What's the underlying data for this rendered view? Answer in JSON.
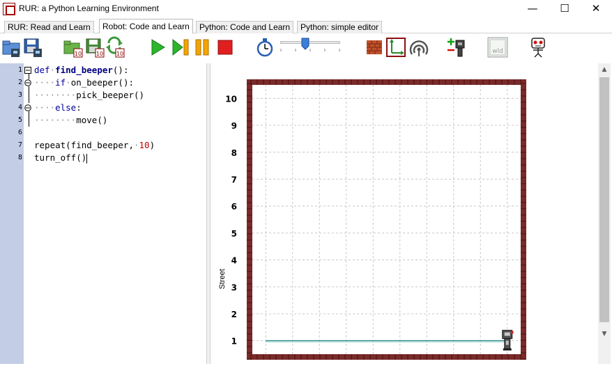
{
  "window": {
    "title": "RUR: a Python Learning Environment",
    "minimize_glyph": "—",
    "maximize_glyph": "☐",
    "close_glyph": "✕"
  },
  "tabs": [
    {
      "label": "RUR: Read and Learn",
      "active": false
    },
    {
      "label": "Robot: Code and Learn",
      "active": true
    },
    {
      "label": "Python: Code and Learn",
      "active": false
    },
    {
      "label": "Python: simple editor",
      "active": false
    }
  ],
  "toolbar": {
    "icons": [
      "open-world-icon",
      "save-world-icon",
      "open-program-icon",
      "save-program-icon",
      "reload-icon",
      "run-icon",
      "step-icon",
      "pause-icon",
      "stop-icon",
      "speed-timer-icon",
      "world-builder-wall-icon",
      "resize-world-icon",
      "beeper-sensor-icon",
      "add-robot-icon",
      "world-file-icon",
      "robot-face-icon"
    ],
    "speed_slider_fraction": 0.4,
    "world_file_label": "wld"
  },
  "editor": {
    "lines": [
      {
        "n": "1"
      },
      {
        "n": "2"
      },
      {
        "n": "3"
      },
      {
        "n": "4"
      },
      {
        "n": "5"
      },
      {
        "n": "6"
      },
      {
        "n": "7"
      },
      {
        "n": "8"
      }
    ],
    "code": {
      "l1_kw": "def",
      "l1_name": "find_beeper",
      "l1_rest": "():",
      "l2_kw": "if",
      "l2_rest": "on_beeper():",
      "l3": "pick_beeper()",
      "l4_kw": "else",
      "l4_rest": ":",
      "l5": "move()",
      "l7_a": "repeat(find_beeper,",
      "l7_num": "10",
      "l7_b": ")",
      "l8": "turn_off()"
    }
  },
  "world": {
    "street_label": "Street",
    "avenues": 10,
    "streets": 10,
    "y_ticks": [
      "1",
      "2",
      "3",
      "4",
      "5",
      "6",
      "7",
      "8",
      "9",
      "10"
    ],
    "robot": {
      "avenue": 10,
      "street": 1,
      "facing": "north"
    },
    "wall_color": "#7a2a2a",
    "grid_color": "#c8c8c8",
    "path_color": "#2e8b8b"
  }
}
